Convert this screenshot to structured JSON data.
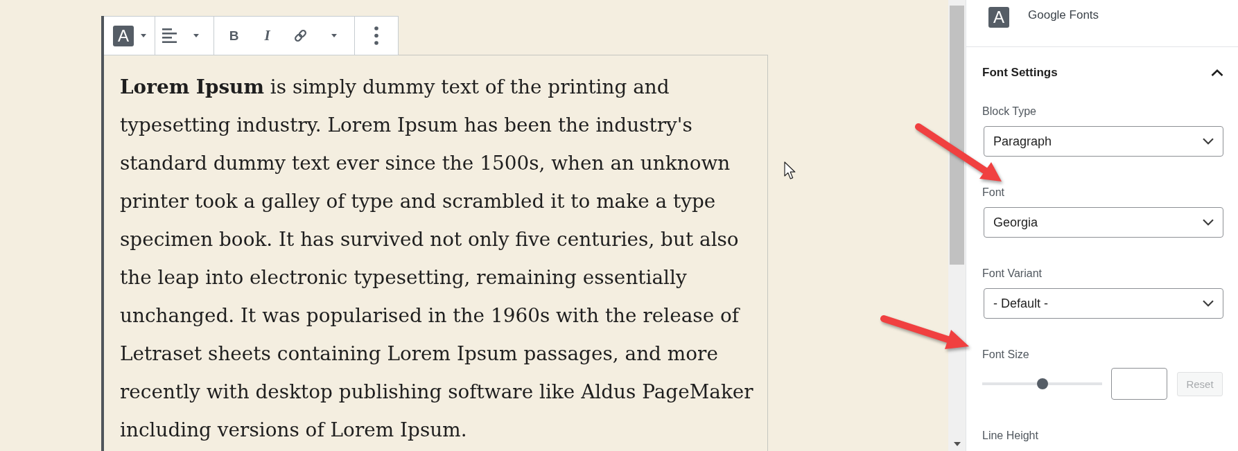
{
  "toolbar": {
    "block_type": {
      "glyph": "A"
    },
    "bold": {
      "glyph": "B"
    },
    "italic": {
      "glyph": "I"
    }
  },
  "editor": {
    "paragraph": "**Lorem Ipsum** is simply dummy text of the printing and typesetting industry. Lorem Ipsum has been the industry's standard dummy text ever since the 1500s, when an unknown printer took a galley of type and scrambled it to make a type specimen book. It has survived not only five centuries, but also the leap into electronic typesetting, remaining essentially unchanged. It was popularised in the 1960s with the release of Letraset sheets containing Lorem Ipsum passages, and more recently with desktop publishing software like Aldus PageMaker including versions of Lorem Ipsum."
  },
  "sidebar": {
    "header": {
      "icon_glyph": "A",
      "title": "Google Fonts"
    },
    "panel": {
      "title": "Font Settings",
      "expanded": true,
      "fields": [
        {
          "kind": "select",
          "label": "Block Type",
          "value": "Paragraph"
        },
        {
          "kind": "select",
          "label": "Font",
          "value": "Georgia"
        },
        {
          "kind": "select",
          "label": "Font Variant",
          "value": "- Default -"
        },
        {
          "kind": "range",
          "label": "Font Size",
          "level": 0.5,
          "reset": {
            "label": "Reset",
            "disabled": true
          }
        },
        {
          "kind": "label",
          "label": "Line Height"
        }
      ]
    }
  }
}
